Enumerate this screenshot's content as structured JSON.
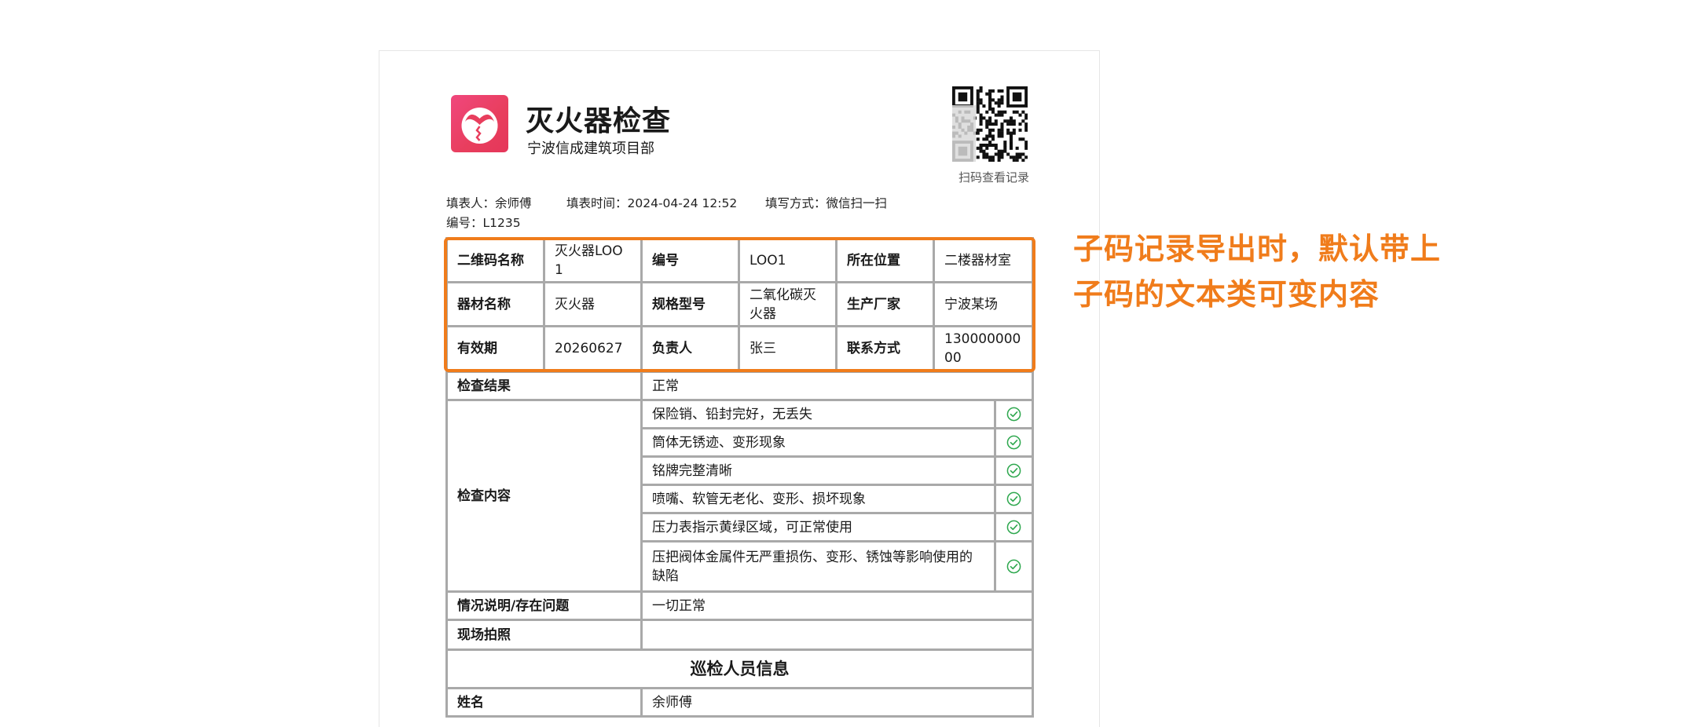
{
  "header": {
    "title": "灭火器检查",
    "subtitle": "宁波信成建筑项目部",
    "qr_caption": "扫码查看记录"
  },
  "meta": {
    "filler": "填表人：余师傅",
    "fill_time": "填表时间：2024-04-24 12:52",
    "fill_method": "填写方式：微信扫一扫",
    "number": "编号：L1235"
  },
  "info_rows": [
    [
      "二维码名称",
      "灭火器LOO1",
      "编号",
      "LOO1",
      "所在位置",
      "二楼器材室"
    ],
    [
      "器材名称",
      "灭火器",
      "规格型号",
      "二氧化碳灭火器",
      "生产厂家",
      "宁波某场"
    ],
    [
      "有效期",
      "20260627",
      "负责人",
      "张三",
      "联系方式",
      "13000000000"
    ]
  ],
  "result": {
    "label": "检查结果",
    "value": "正常"
  },
  "inspection": {
    "label": "检查内容",
    "items": [
      "保险销、铅封完好，无丢失",
      "筒体无锈迹、变形现象",
      "铭牌完整清晰",
      "喷嘴、软管无老化、变形、损坏现象",
      "压力表指示黄绿区域，可正常使用",
      "压把阀体金属件无严重损伤、变形、锈蚀等影响使用的缺陷"
    ]
  },
  "situation": {
    "label": "情况说明/存在问题",
    "value": "一切正常"
  },
  "photo": {
    "label": "现场拍照",
    "value": ""
  },
  "inspector_section": {
    "title": "巡检人员信息"
  },
  "inspector": {
    "name_label": "姓名",
    "name_value": "余师傅"
  },
  "annotation": {
    "line1": "子码记录导出时，默认带上",
    "line2": "子码的文本类可变内容"
  },
  "colors": {
    "accent": "#f07c1b",
    "check": "#2fa84f",
    "border": "#a9a9a9",
    "logo": "#e83e5d"
  },
  "icons": {
    "check": "check-circle-icon",
    "logo": "app-logo-icon"
  }
}
